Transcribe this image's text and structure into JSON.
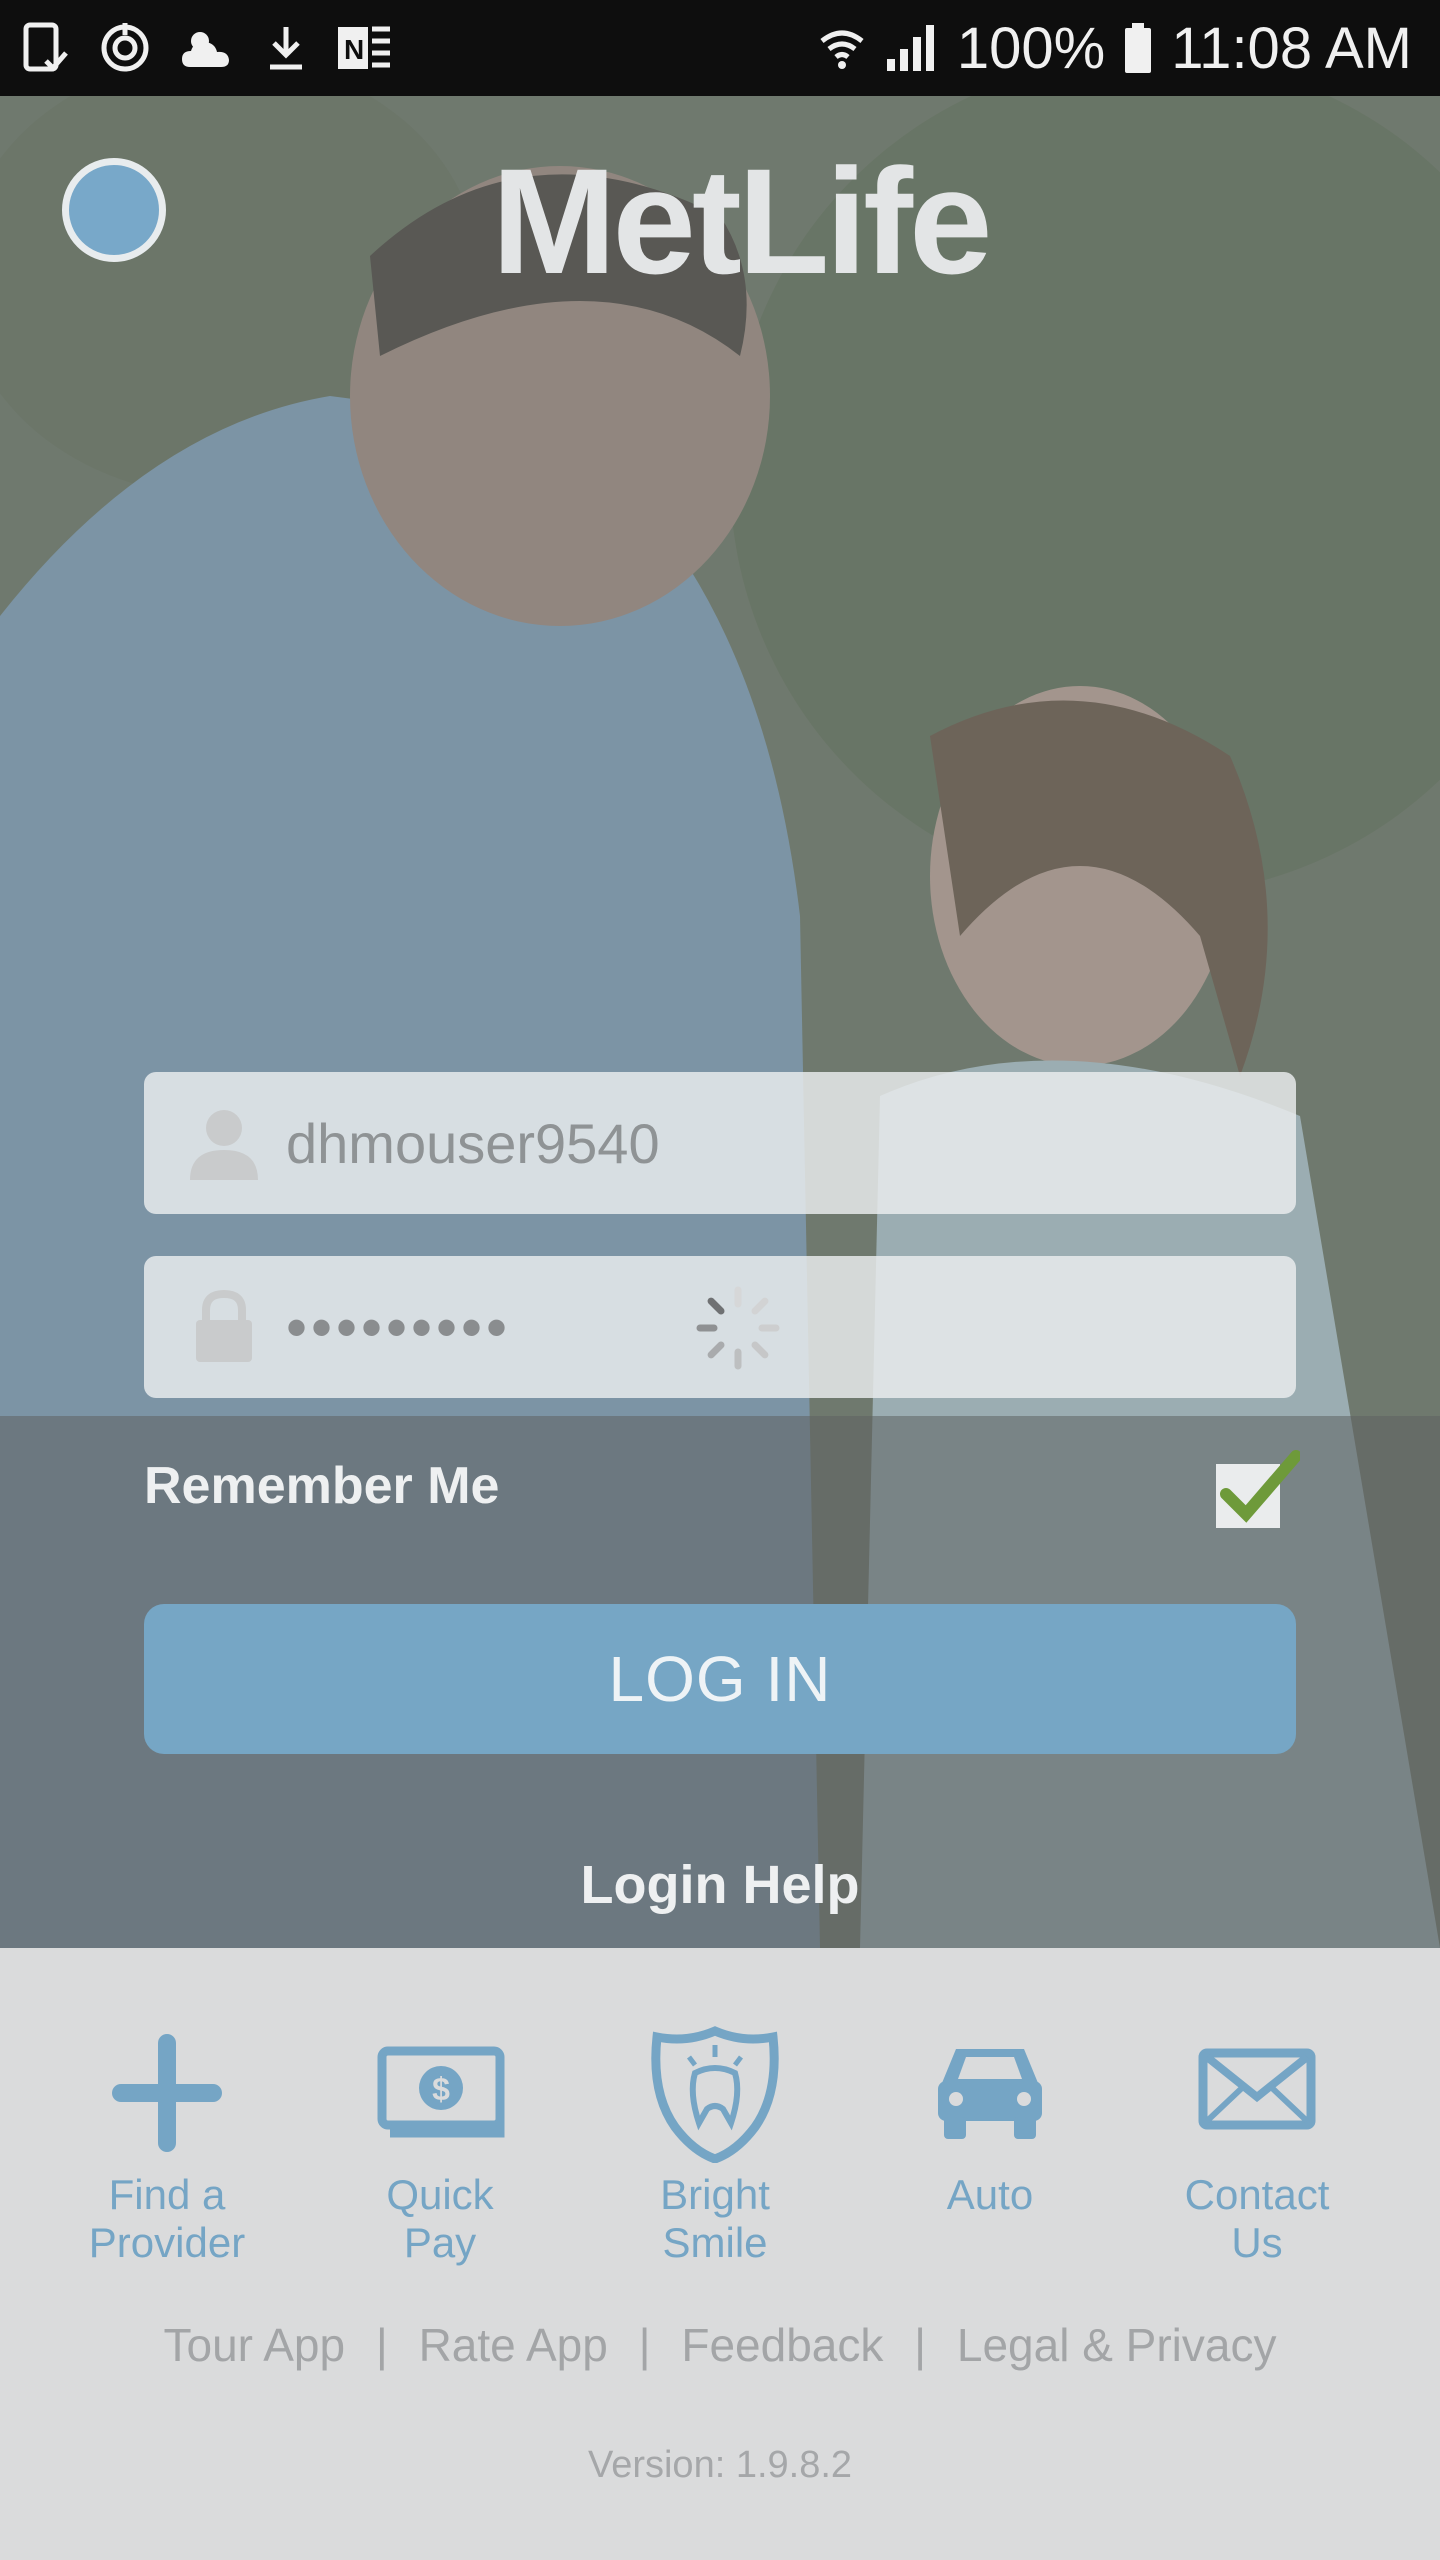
{
  "status_bar": {
    "battery": "100%",
    "time": "11:08 AM",
    "left_icons": [
      "tablet-check-icon",
      "sync-icon",
      "partly-cloudy-icon",
      "download-icon",
      "onenote-icon"
    ],
    "right_icons": [
      "wifi-icon",
      "signal-icon",
      "battery-icon"
    ]
  },
  "header": {
    "logo_text": "MetLife"
  },
  "login": {
    "username_value": "dhmouser9540",
    "password_mask": "•••••••••",
    "remember_label": "Remember Me",
    "remember_checked": true,
    "login_button": "LOG IN",
    "help_link": "Login Help",
    "loading": true
  },
  "shortcuts": [
    {
      "label": "Find a\nProvider",
      "icon": "plus-icon"
    },
    {
      "label": "Quick\nPay",
      "icon": "dollar-bill-icon"
    },
    {
      "label": "Bright\nSmile",
      "icon": "tooth-shield-icon"
    },
    {
      "label": "Auto",
      "icon": "car-icon"
    },
    {
      "label": "Contact\nUs",
      "icon": "envelope-icon"
    }
  ],
  "footer": {
    "links": [
      "Tour App",
      "Rate App",
      "Feedback",
      "Legal & Privacy"
    ],
    "separator": "|",
    "version": "Version: 1.9.8.2"
  },
  "colors": {
    "accent": "#76a6c5",
    "status_bar_bg": "#0e0e0e",
    "bottom_bg": "#dadbdc",
    "check_green": "#6e9a3a"
  }
}
